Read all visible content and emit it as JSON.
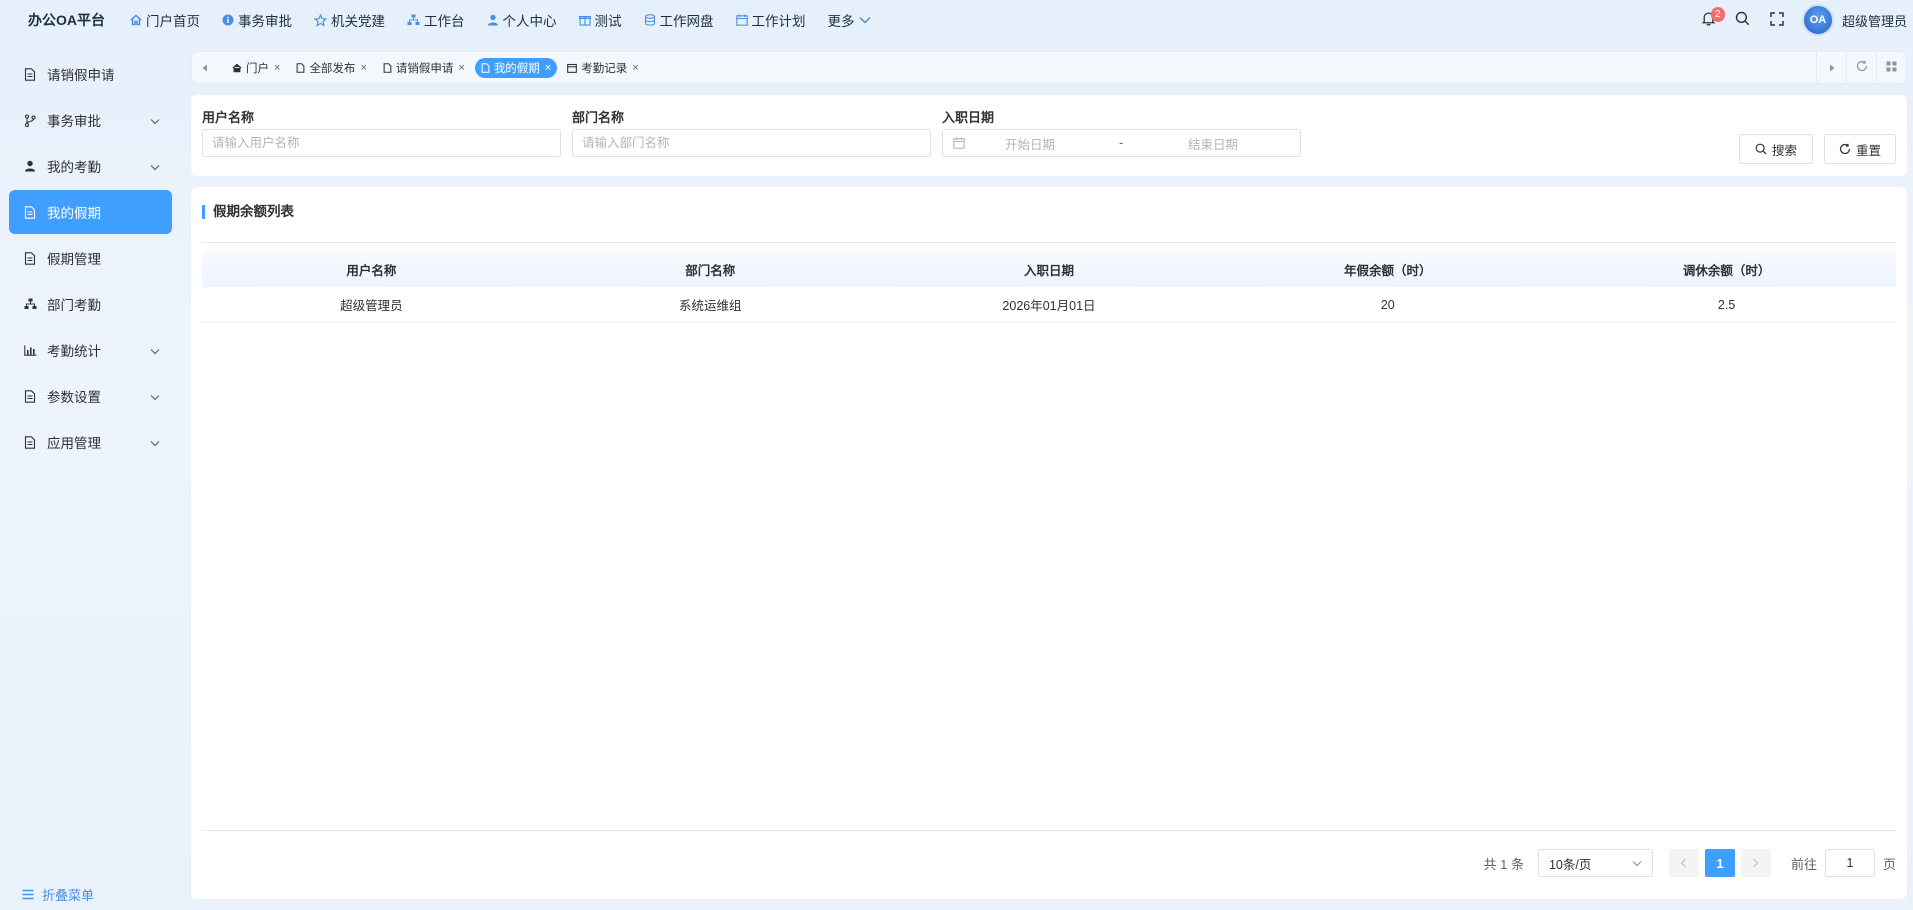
{
  "app": {
    "brand": "办公OA平台"
  },
  "topnav": [
    {
      "label": "门户首页",
      "icon": "home-icon"
    },
    {
      "label": "事务审批",
      "icon": "info-icon"
    },
    {
      "label": "机关党建",
      "icon": "star-icon"
    },
    {
      "label": "工作台",
      "icon": "sitemap-icon"
    },
    {
      "label": "个人中心",
      "icon": "user-icon"
    },
    {
      "label": "测试",
      "icon": "gift-icon"
    },
    {
      "label": "工作网盘",
      "icon": "database-icon"
    },
    {
      "label": "工作计划",
      "icon": "calendar-icon"
    },
    {
      "label": "更多",
      "icon": "chevron-down-icon"
    }
  ],
  "header": {
    "notification_count": "2",
    "avatar_text": "OA",
    "username": "超级管理员"
  },
  "sidebar": {
    "items": [
      {
        "label": "请销假申请",
        "icon": "document-icon",
        "expandable": false,
        "active": false
      },
      {
        "label": "事务审批",
        "icon": "branch-icon",
        "expandable": true,
        "active": false
      },
      {
        "label": "我的考勤",
        "icon": "user-icon",
        "expandable": true,
        "active": false
      },
      {
        "label": "我的假期",
        "icon": "document-icon",
        "expandable": false,
        "active": true
      },
      {
        "label": "假期管理",
        "icon": "document-icon",
        "expandable": false,
        "active": false
      },
      {
        "label": "部门考勤",
        "icon": "org-chart-icon",
        "expandable": false,
        "active": false
      },
      {
        "label": "考勤统计",
        "icon": "bar-chart-icon",
        "expandable": true,
        "active": false
      },
      {
        "label": "参数设置",
        "icon": "document-icon",
        "expandable": true,
        "active": false
      },
      {
        "label": "应用管理",
        "icon": "document-icon",
        "expandable": true,
        "active": false
      }
    ],
    "collapse_label": "折叠菜单"
  },
  "tabs": [
    {
      "label": "门户",
      "icon": "home-icon",
      "active": false
    },
    {
      "label": "全部发布",
      "icon": "document-icon",
      "active": false
    },
    {
      "label": "请销假申请",
      "icon": "document-icon",
      "active": false
    },
    {
      "label": "我的假期",
      "icon": "document-icon",
      "active": true
    },
    {
      "label": "考勤记录",
      "icon": "calendar-icon",
      "active": false
    }
  ],
  "filter": {
    "username_label": "用户名称",
    "username_placeholder": "请输入用户名称",
    "dept_label": "部门名称",
    "dept_placeholder": "请输入部门名称",
    "date_label": "入职日期",
    "start_placeholder": "开始日期",
    "separator": "-",
    "end_placeholder": "结束日期",
    "search_label": "搜索",
    "reset_label": "重置"
  },
  "list": {
    "title": "假期余额列表",
    "columns": [
      "用户名称",
      "部门名称",
      "入职日期",
      "年假余额（时）",
      "调休余额（时）"
    ],
    "rows": [
      [
        "超级管理员",
        "系统运维组",
        "2026年01月01日",
        "20",
        "2.5"
      ]
    ]
  },
  "pagination": {
    "total_text": "共 1 条",
    "page_size": "10条/页",
    "current_page": "1",
    "goto_label": "前往",
    "goto_value": "1",
    "page_unit": "页"
  }
}
